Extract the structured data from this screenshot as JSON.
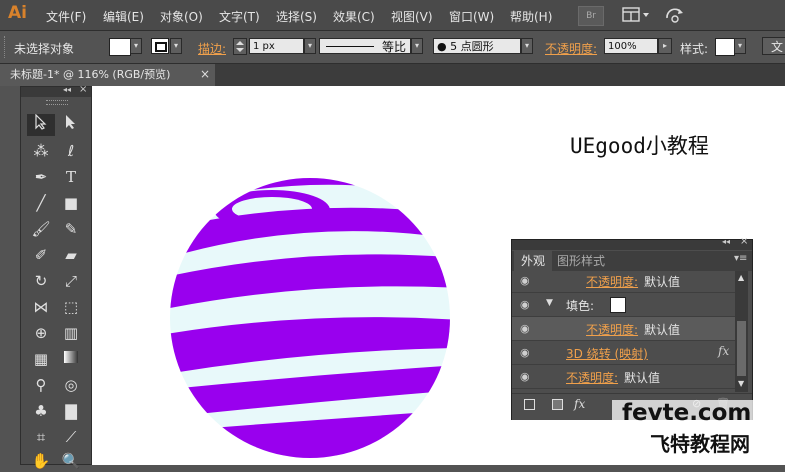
{
  "app": {
    "logo": "Ai"
  },
  "menu": [
    "文件(F)",
    "编辑(E)",
    "对象(O)",
    "文字(T)",
    "选择(S)",
    "效果(C)",
    "视图(V)",
    "窗口(W)",
    "帮助(H)"
  ],
  "menubar_icons": {
    "bridge": "Br",
    "arrange": "arrange-documents-icon",
    "sync": "sync-icon"
  },
  "control_bar": {
    "selection": "未选择对象",
    "stroke_label": "描边:",
    "stroke_width": "1 px",
    "stroke_profile": "等比",
    "brush": "5 点圆形",
    "opacity_label": "不透明度:",
    "opacity_value": "100%",
    "style_label": "样式:",
    "cut_label": "文"
  },
  "document": {
    "tab_title": "未标题-1* @ 116% (RGB/预览)",
    "close": "×"
  },
  "canvas": {
    "heading": "UEgood小教程"
  },
  "colors": {
    "sphere_base": "#E8F9FA",
    "stripe": "#9900EE",
    "accent_orange": "#F0A04B"
  },
  "tools": [
    "selection-tool",
    "direct-selection-tool",
    "magic-wand-tool",
    "lasso-tool",
    "pen-tool",
    "type-tool",
    "line-tool",
    "rectangle-tool",
    "paintbrush-tool",
    "pencil-tool",
    "blob-brush-tool",
    "eraser-tool",
    "rotate-tool",
    "scale-tool",
    "width-tool",
    "free-transform-tool",
    "shape-builder-tool",
    "perspective-grid-tool",
    "mesh-tool",
    "gradient-tool",
    "eyedropper-tool",
    "blend-tool",
    "symbol-sprayer-tool",
    "column-graph-tool",
    "artboard-tool",
    "slice-tool",
    "hand-tool",
    "zoom-tool"
  ],
  "appearance_panel": {
    "tab_active": "外观",
    "tab_inactive": "图形样式",
    "rows": [
      {
        "label": "不透明度:",
        "value": "默认值"
      },
      {
        "label": "填色:",
        "value": ""
      },
      {
        "label": "不透明度:",
        "value": "默认值"
      },
      {
        "label": "3D 绕转 (映射)",
        "value": "fx"
      },
      {
        "label": "不透明度:",
        "value": "默认值"
      }
    ],
    "bottom_icons": [
      "new-art-icon",
      "clear-appearance-icon",
      "fx-icon",
      "duplicate-icon",
      "delete-icon"
    ],
    "fx_label": "fx"
  },
  "watermark": {
    "line1": "fevte.com",
    "line2": "飞特教程网"
  }
}
